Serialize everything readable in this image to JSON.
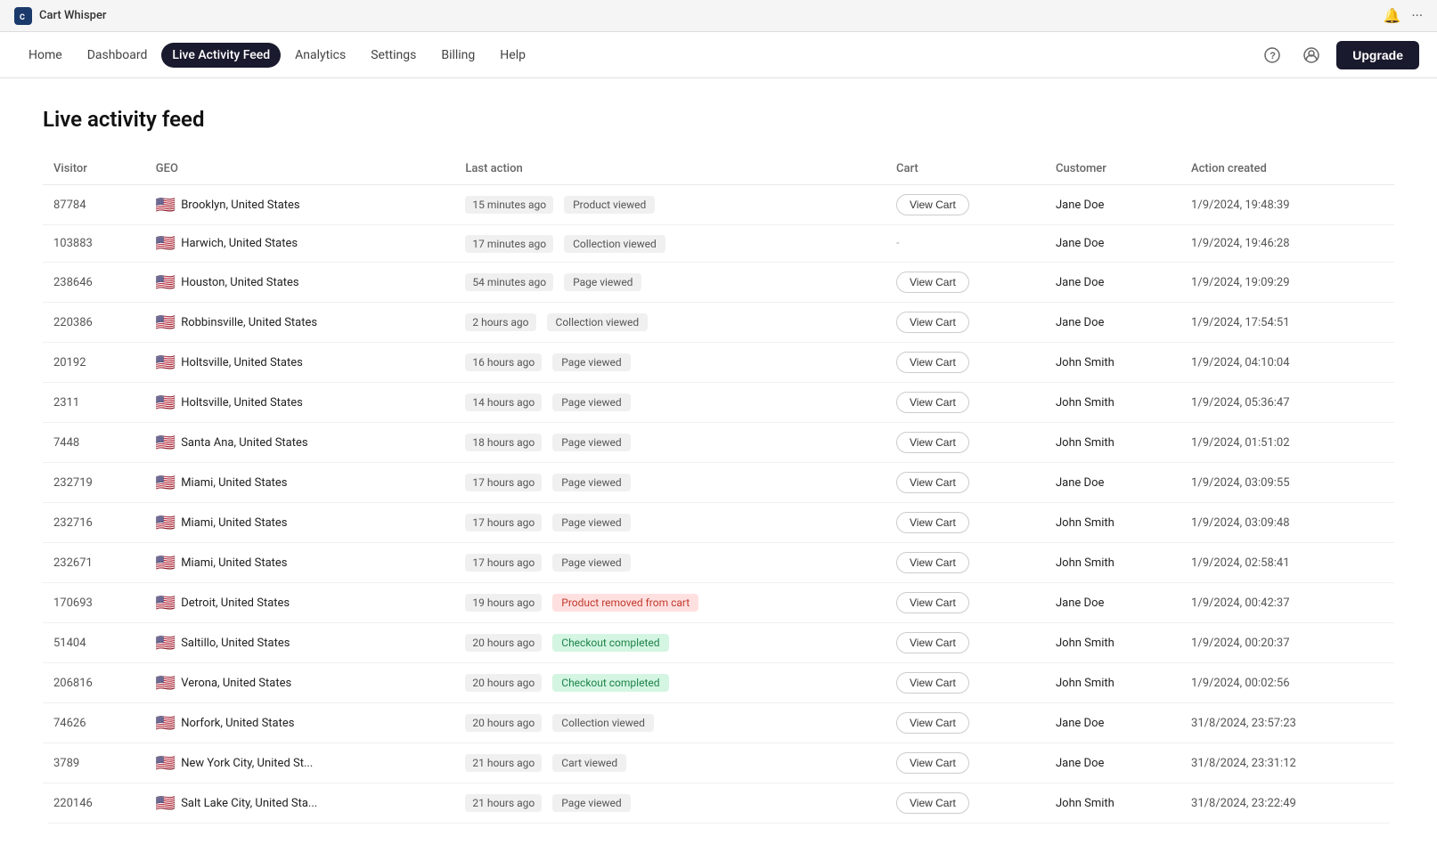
{
  "browser": {
    "app_icon": "C",
    "app_title": "Cart Whisper",
    "bell_icon": "🔔",
    "dots_icon": "···"
  },
  "nav": {
    "links": [
      {
        "id": "home",
        "label": "Home",
        "active": false
      },
      {
        "id": "dashboard",
        "label": "Dashboard",
        "active": false
      },
      {
        "id": "live-activity-feed",
        "label": "Live Activity Feed",
        "active": true
      },
      {
        "id": "analytics",
        "label": "Analytics",
        "active": false
      },
      {
        "id": "settings",
        "label": "Settings",
        "active": false
      },
      {
        "id": "billing",
        "label": "Billing",
        "active": false
      },
      {
        "id": "help",
        "label": "Help",
        "active": false
      }
    ],
    "help_icon": "?",
    "account_icon": "👤",
    "upgrade_label": "Upgrade"
  },
  "page": {
    "title": "Live activity feed"
  },
  "table": {
    "columns": [
      {
        "id": "visitor",
        "label": "Visitor"
      },
      {
        "id": "geo",
        "label": "GEO"
      },
      {
        "id": "last_action",
        "label": "Last action"
      },
      {
        "id": "cart",
        "label": "Cart"
      },
      {
        "id": "customer",
        "label": "Customer"
      },
      {
        "id": "action_created",
        "label": "Action created"
      }
    ],
    "rows": [
      {
        "visitor": "87784",
        "flag": "🇺🇸",
        "geo": "Brooklyn, United States",
        "time": "15 minutes ago",
        "action": "Product viewed",
        "action_type": "normal",
        "cart": "View Cart",
        "has_cart": true,
        "customer": "Jane Doe",
        "action_created": "1/9/2024, 19:48:39"
      },
      {
        "visitor": "103883",
        "flag": "🇺🇸",
        "geo": "Harwich, United States",
        "time": "17 minutes ago",
        "action": "Collection viewed",
        "action_type": "normal",
        "cart": "-",
        "has_cart": false,
        "customer": "Jane Doe",
        "action_created": "1/9/2024, 19:46:28"
      },
      {
        "visitor": "238646",
        "flag": "🇺🇸",
        "geo": "Houston, United States",
        "time": "54 minutes ago",
        "action": "Page viewed",
        "action_type": "normal",
        "cart": "View Cart",
        "has_cart": true,
        "customer": "Jane Doe",
        "action_created": "1/9/2024, 19:09:29"
      },
      {
        "visitor": "220386",
        "flag": "🇺🇸",
        "geo": "Robbinsville, United States",
        "time": "2 hours ago",
        "action": "Collection viewed",
        "action_type": "normal",
        "cart": "View Cart",
        "has_cart": true,
        "customer": "Jane Doe",
        "action_created": "1/9/2024, 17:54:51"
      },
      {
        "visitor": "20192",
        "flag": "🇺🇸",
        "geo": "Holtsville, United States",
        "time": "16 hours ago",
        "action": "Page viewed",
        "action_type": "normal",
        "cart": "View Cart",
        "has_cart": true,
        "customer": "John Smith",
        "action_created": "1/9/2024, 04:10:04"
      },
      {
        "visitor": "2311",
        "flag": "🇺🇸",
        "geo": "Holtsville, United States",
        "time": "14 hours ago",
        "action": "Page viewed",
        "action_type": "normal",
        "cart": "View Cart",
        "has_cart": true,
        "customer": "John Smith",
        "action_created": "1/9/2024, 05:36:47"
      },
      {
        "visitor": "7448",
        "flag": "🇺🇸",
        "geo": "Santa Ana, United States",
        "time": "18 hours ago",
        "action": "Page viewed",
        "action_type": "normal",
        "cart": "View Cart",
        "has_cart": true,
        "customer": "John Smith",
        "action_created": "1/9/2024, 01:51:02"
      },
      {
        "visitor": "232719",
        "flag": "🇺🇸",
        "geo": "Miami, United States",
        "time": "17 hours ago",
        "action": "Page viewed",
        "action_type": "normal",
        "cart": "View Cart",
        "has_cart": true,
        "customer": "Jane Doe",
        "action_created": "1/9/2024, 03:09:55"
      },
      {
        "visitor": "232716",
        "flag": "🇺🇸",
        "geo": "Miami, United States",
        "time": "17 hours ago",
        "action": "Page viewed",
        "action_type": "normal",
        "cart": "View Cart",
        "has_cart": true,
        "customer": "John Smith",
        "action_created": "1/9/2024, 03:09:48"
      },
      {
        "visitor": "232671",
        "flag": "🇺🇸",
        "geo": "Miami, United States",
        "time": "17 hours ago",
        "action": "Page viewed",
        "action_type": "normal",
        "cart": "View Cart",
        "has_cart": true,
        "customer": "John Smith",
        "action_created": "1/9/2024, 02:58:41"
      },
      {
        "visitor": "170693",
        "flag": "🇺🇸",
        "geo": "Detroit, United States",
        "time": "19 hours ago",
        "action": "Product removed from cart",
        "action_type": "product-removed",
        "cart": "View Cart",
        "has_cart": true,
        "customer": "Jane Doe",
        "action_created": "1/9/2024, 00:42:37"
      },
      {
        "visitor": "51404",
        "flag": "🇺🇸",
        "geo": "Saltillo, United States",
        "time": "20 hours ago",
        "action": "Checkout completed",
        "action_type": "checkout-completed",
        "cart": "View Cart",
        "has_cart": true,
        "customer": "John Smith",
        "action_created": "1/9/2024, 00:20:37"
      },
      {
        "visitor": "206816",
        "flag": "🇺🇸",
        "geo": "Verona, United States",
        "time": "20 hours ago",
        "action": "Checkout completed",
        "action_type": "checkout-completed",
        "cart": "View Cart",
        "has_cart": true,
        "customer": "John Smith",
        "action_created": "1/9/2024, 00:02:56"
      },
      {
        "visitor": "74626",
        "flag": "🇺🇸",
        "geo": "Norfork, United States",
        "time": "20 hours ago",
        "action": "Collection viewed",
        "action_type": "normal",
        "cart": "View Cart",
        "has_cart": true,
        "customer": "Jane Doe",
        "action_created": "31/8/2024, 23:57:23"
      },
      {
        "visitor": "3789",
        "flag": "🇺🇸",
        "geo": "New York City, United St...",
        "time": "21 hours ago",
        "action": "Cart viewed",
        "action_type": "normal",
        "cart": "View Cart",
        "has_cart": true,
        "customer": "Jane Doe",
        "action_created": "31/8/2024, 23:31:12"
      },
      {
        "visitor": "220146",
        "flag": "🇺🇸",
        "geo": "Salt Lake City, United Sta...",
        "time": "21 hours ago",
        "action": "Page viewed",
        "action_type": "normal",
        "cart": "View Cart",
        "has_cart": true,
        "customer": "John Smith",
        "action_created": "31/8/2024, 23:22:49"
      }
    ]
  }
}
